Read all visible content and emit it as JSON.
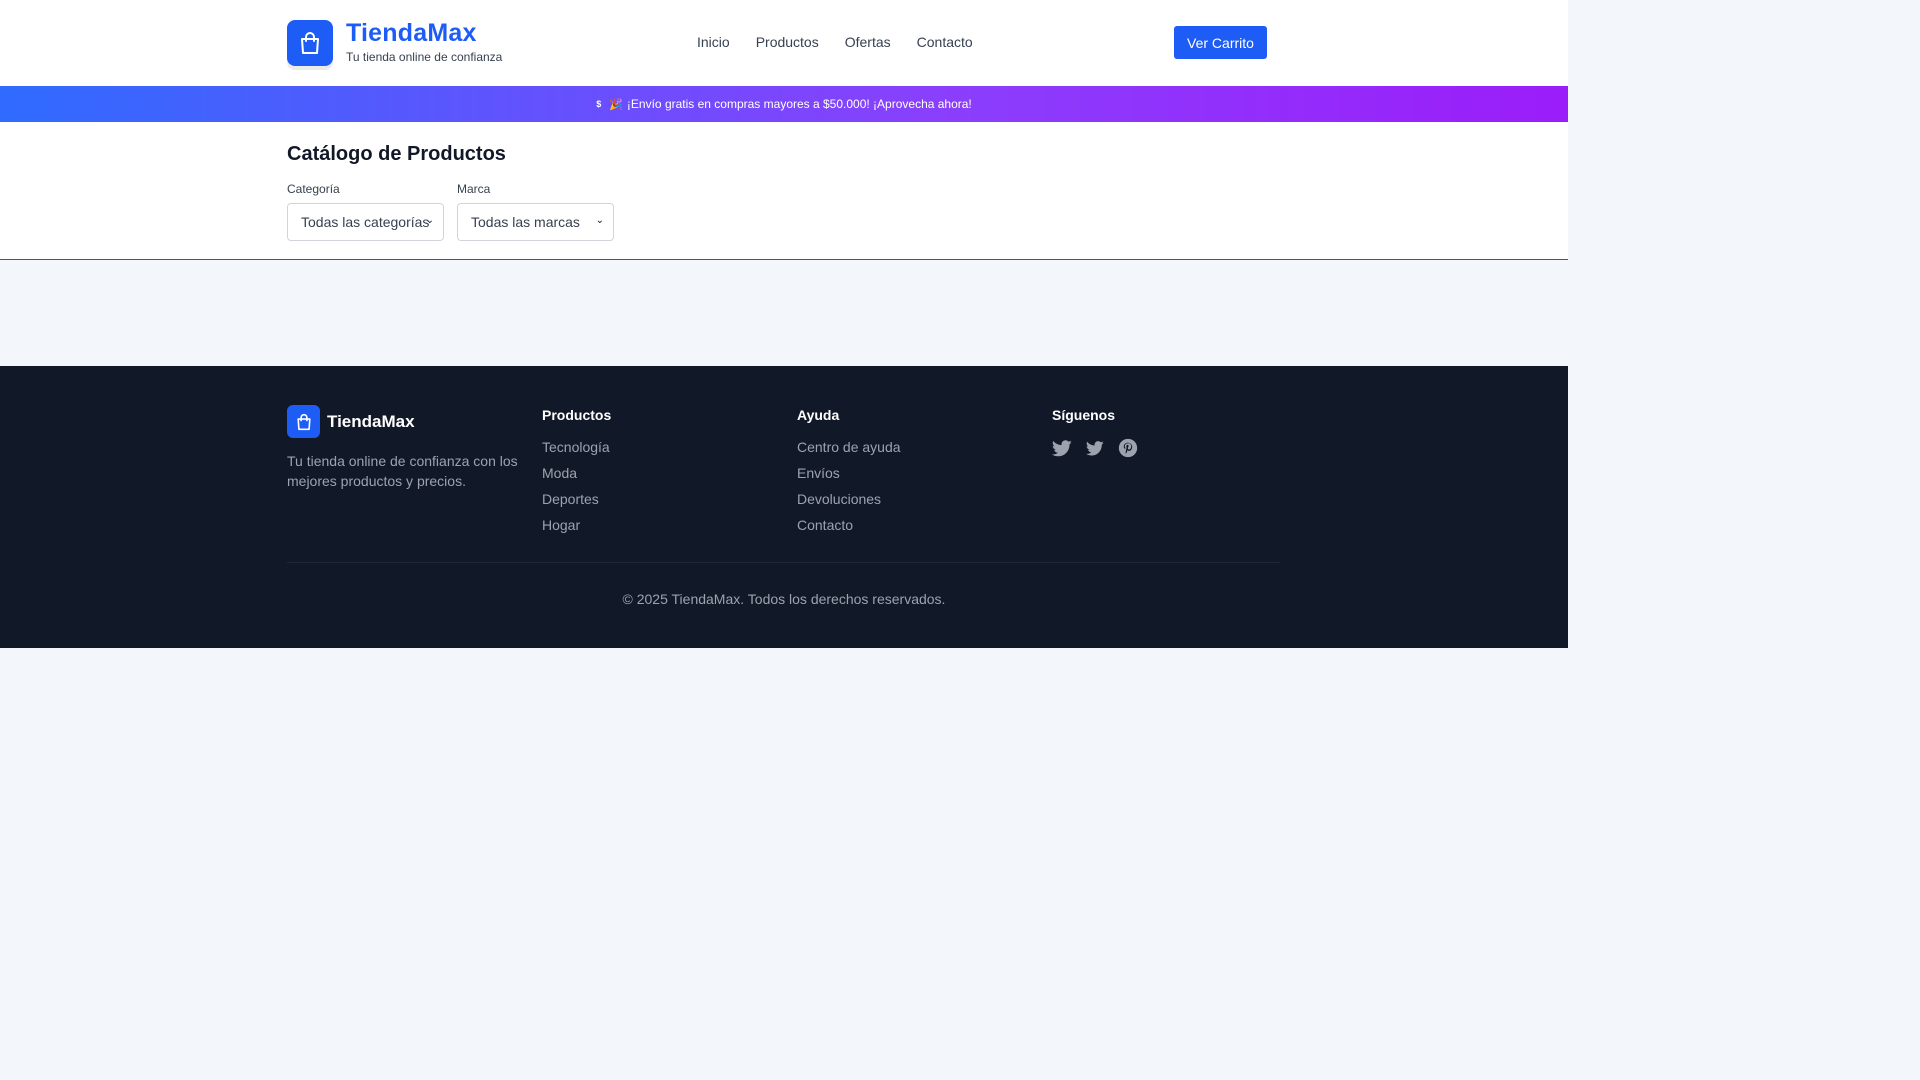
{
  "header": {
    "brand_title": "TiendaMax",
    "brand_subtitle": "Tu tienda online de confianza",
    "nav": [
      "Inicio",
      "Productos",
      "Ofertas",
      "Contacto"
    ],
    "cart_button": "Ver Carrito"
  },
  "promo": {
    "dollar_icon": "$",
    "party_icon": "🎉",
    "text": "¡Envío gratis en compras mayores a $50.000! ¡Aprovecha ahora!"
  },
  "catalog": {
    "title": "Catálogo de Productos",
    "category_label": "Categoría",
    "category_value": "Todas las categorías",
    "brand_label": "Marca",
    "brand_value": "Todas las marcas"
  },
  "footer": {
    "brand": "TiendaMax",
    "description": "Tu tienda online de confianza con los mejores productos y precios.",
    "products_title": "Productos",
    "products_links": [
      "Tecnología",
      "Moda",
      "Deportes",
      "Hogar"
    ],
    "help_title": "Ayuda",
    "help_links": [
      "Centro de ayuda",
      "Envíos",
      "Devoluciones",
      "Contacto"
    ],
    "social_title": "Síguenos",
    "social_icons": [
      "twitter-icon",
      "twitter-icon",
      "pinterest-icon"
    ],
    "copyright": "© 2025 TiendaMax. Todos los derechos reservados."
  },
  "colors": {
    "primary": "#1d5cf5",
    "footer_bg": "#111827",
    "page_bg": "#f3f6fb",
    "promo_start": "#2f6bff",
    "promo_end": "#9b1dfa"
  }
}
